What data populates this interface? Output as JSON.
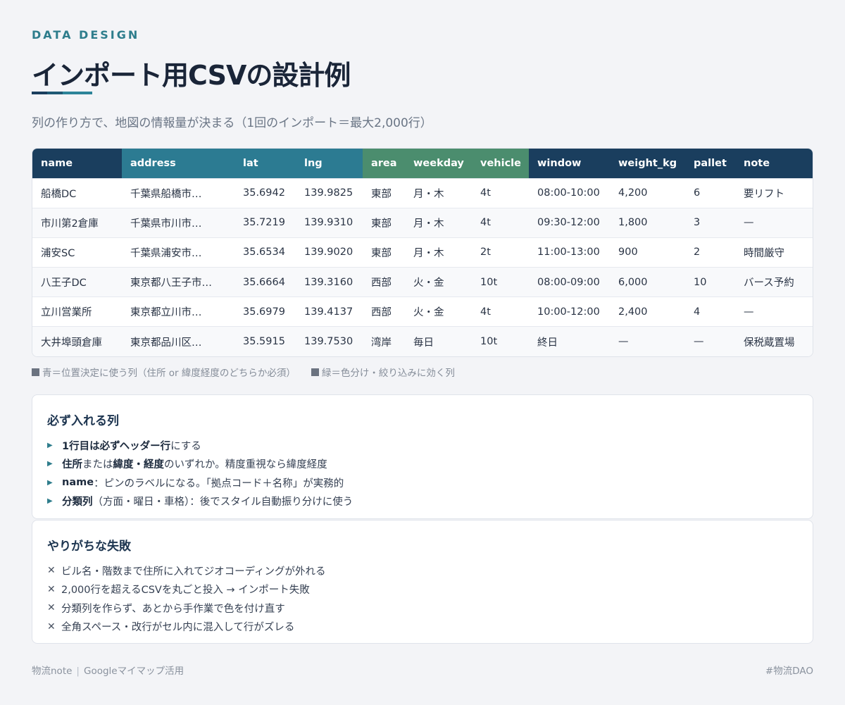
{
  "header": {
    "eyebrow": "DATA DESIGN",
    "title": "インポート用CSVの設計例",
    "subtitle": "列の作り方で、地図の情報量が決まる（1回のインポート＝最大2,000行）"
  },
  "colors": {
    "navy": "#1a3e5e",
    "blue": "#2c7b92",
    "green": "#4b8d6e",
    "accent": "#2e7d8c"
  },
  "table": {
    "columns": [
      "name",
      "address",
      "lat",
      "lng",
      "area",
      "weekday",
      "vehicle",
      "window",
      "weight_kg",
      "pallet",
      "note"
    ],
    "rows": [
      [
        "船橋DC",
        "千葉県船橋市…",
        "35.6942",
        "139.9825",
        "東部",
        "月・木",
        "4t",
        "08:00-10:00",
        "4,200",
        "6",
        "要リフト"
      ],
      [
        "市川第2倉庫",
        "千葉県市川市…",
        "35.7219",
        "139.9310",
        "東部",
        "月・木",
        "4t",
        "09:30-12:00",
        "1,800",
        "3",
        "—"
      ],
      [
        "浦安SC",
        "千葉県浦安市…",
        "35.6534",
        "139.9020",
        "東部",
        "月・木",
        "2t",
        "11:00-13:00",
        "900",
        "2",
        "時間厳守"
      ],
      [
        "八王子DC",
        "東京都八王子市…",
        "35.6664",
        "139.3160",
        "西部",
        "火・金",
        "10t",
        "08:00-09:00",
        "6,000",
        "10",
        "バース予約"
      ],
      [
        "立川営業所",
        "東京都立川市…",
        "35.6979",
        "139.4137",
        "西部",
        "火・金",
        "4t",
        "10:00-12:00",
        "2,400",
        "4",
        "—"
      ],
      [
        "大井埠頭倉庫",
        "東京都品川区…",
        "35.5915",
        "139.7530",
        "湾岸",
        "毎日",
        "10t",
        "終日",
        "—",
        "—",
        "保税蔵置場"
      ]
    ]
  },
  "legend": {
    "blue": "青＝位置決定に使う列（住所 or 緯度経度のどちらか必須）",
    "green": "緑＝色分け・絞り込みに効く列"
  },
  "required": {
    "title": "必ず入れる列",
    "items": [
      {
        "bold": "1行目は必ずヘッダー行",
        "rest": "にする"
      },
      {
        "bold": "住所",
        "mid": "または",
        "bold2": "緯度・経度",
        "rest": "のいずれか。精度重視なら緯度経度"
      },
      {
        "bold": "name",
        "rest": "：ピンのラベルになる。「拠点コード＋名称」が実務的"
      },
      {
        "bold": "分類列",
        "rest": "（方面・曜日・車格）：後でスタイル自動振り分けに使う"
      }
    ]
  },
  "mistakes": {
    "title": "やりがちな失敗",
    "items": [
      "ビル名・階数まで住所に入れてジオコーディングが外れる",
      "2,000行を超えるCSVを丸ごと投入 → インポート失敗",
      "分類列を作らず、あとから手作業で色を付け直す",
      "全角スペース・改行がセル内に混入して行がズレる"
    ]
  },
  "footer": {
    "left_a": "物流note",
    "left_sep": "|",
    "left_b": "Googleマイマップ活用",
    "right": "#物流DAO"
  }
}
